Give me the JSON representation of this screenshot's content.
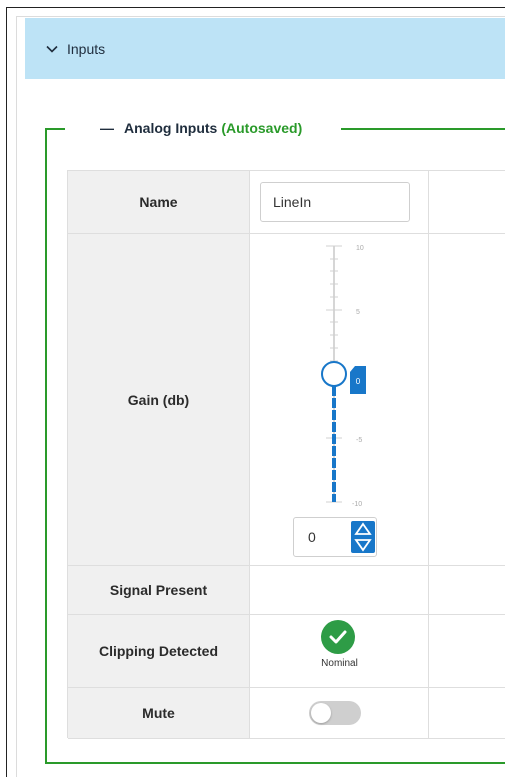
{
  "section": {
    "title": "Inputs"
  },
  "analog_inputs": {
    "legend_title": "Analog Inputs",
    "legend_status": "(Autosaved)",
    "status_color": "#2a9a2a"
  },
  "rows": {
    "name": {
      "label": "Name",
      "value": "LineIn"
    },
    "gain": {
      "label": "Gain (db)",
      "value": "0",
      "scale_max": 10,
      "scale_min": -10,
      "tick_labels": [
        "10",
        "5",
        "0",
        "-5",
        "-10"
      ]
    },
    "signal_present": {
      "label": "Signal Present"
    },
    "clipping": {
      "label": "Clipping Detected",
      "status": "Nominal",
      "icon": "check-circle-icon"
    },
    "mute": {
      "label": "Mute",
      "on": false
    }
  },
  "colors": {
    "accent": "#1877c9",
    "header_bg": "#bde3f6",
    "ok_green": "#2e9c46"
  }
}
